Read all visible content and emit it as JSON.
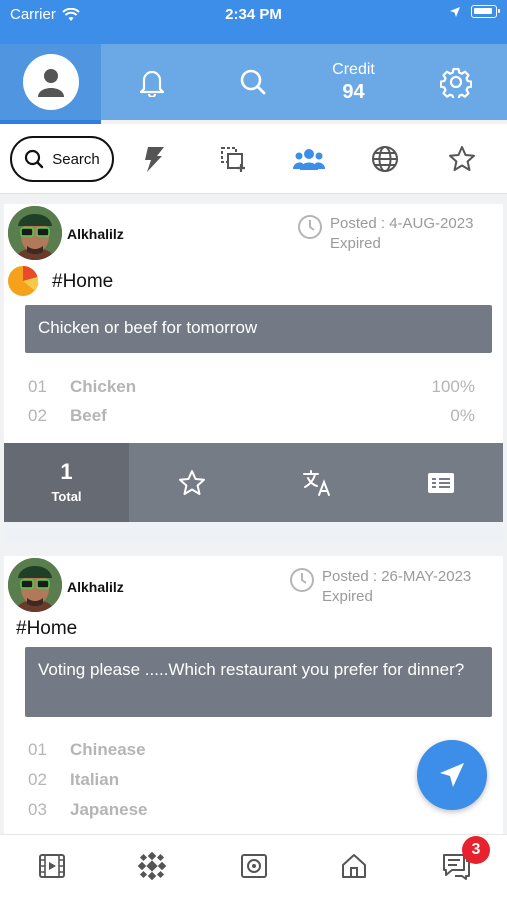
{
  "status_bar": {
    "carrier": "Carrier",
    "time": "2:34 PM"
  },
  "top_nav": {
    "tabs": [
      "profile",
      "notifications",
      "search",
      "credit",
      "settings"
    ],
    "credit_label": "Credit",
    "credit_value": "94"
  },
  "filter_bar": {
    "search_label": "Search",
    "icons": [
      "flash-icon",
      "copy-add-icon",
      "group-icon",
      "globe-icon",
      "star-icon"
    ]
  },
  "posts": [
    {
      "username": "Alkhalilz",
      "posted": "Posted : 4-AUG-2023",
      "status": "Expired",
      "hashtag": "#Home",
      "question": "Chicken or beef for tomorrow",
      "options": [
        {
          "num": "01",
          "name": "Chicken",
          "pct": "100%"
        },
        {
          "num": "02",
          "name": "Beef",
          "pct": "0%"
        }
      ],
      "total_count": "1",
      "total_label": "Total"
    },
    {
      "username": "Alkhalilz",
      "posted": "Posted : 26-MAY-2023",
      "status": "Expired",
      "hashtag": "#Home",
      "question": "Voting please .....Which restaurant you prefer for dinner?",
      "options": [
        {
          "num": "01",
          "name": "Chinease"
        },
        {
          "num": "02",
          "name": "Italian"
        },
        {
          "num": "03",
          "name": "Japanese"
        }
      ]
    }
  ],
  "bottom_bar": {
    "message_badge": "3"
  },
  "colors": {
    "primary": "#3d8ee8",
    "nav": "#6aa8e6",
    "question_bg": "#747a85",
    "badge": "#e8212f"
  }
}
